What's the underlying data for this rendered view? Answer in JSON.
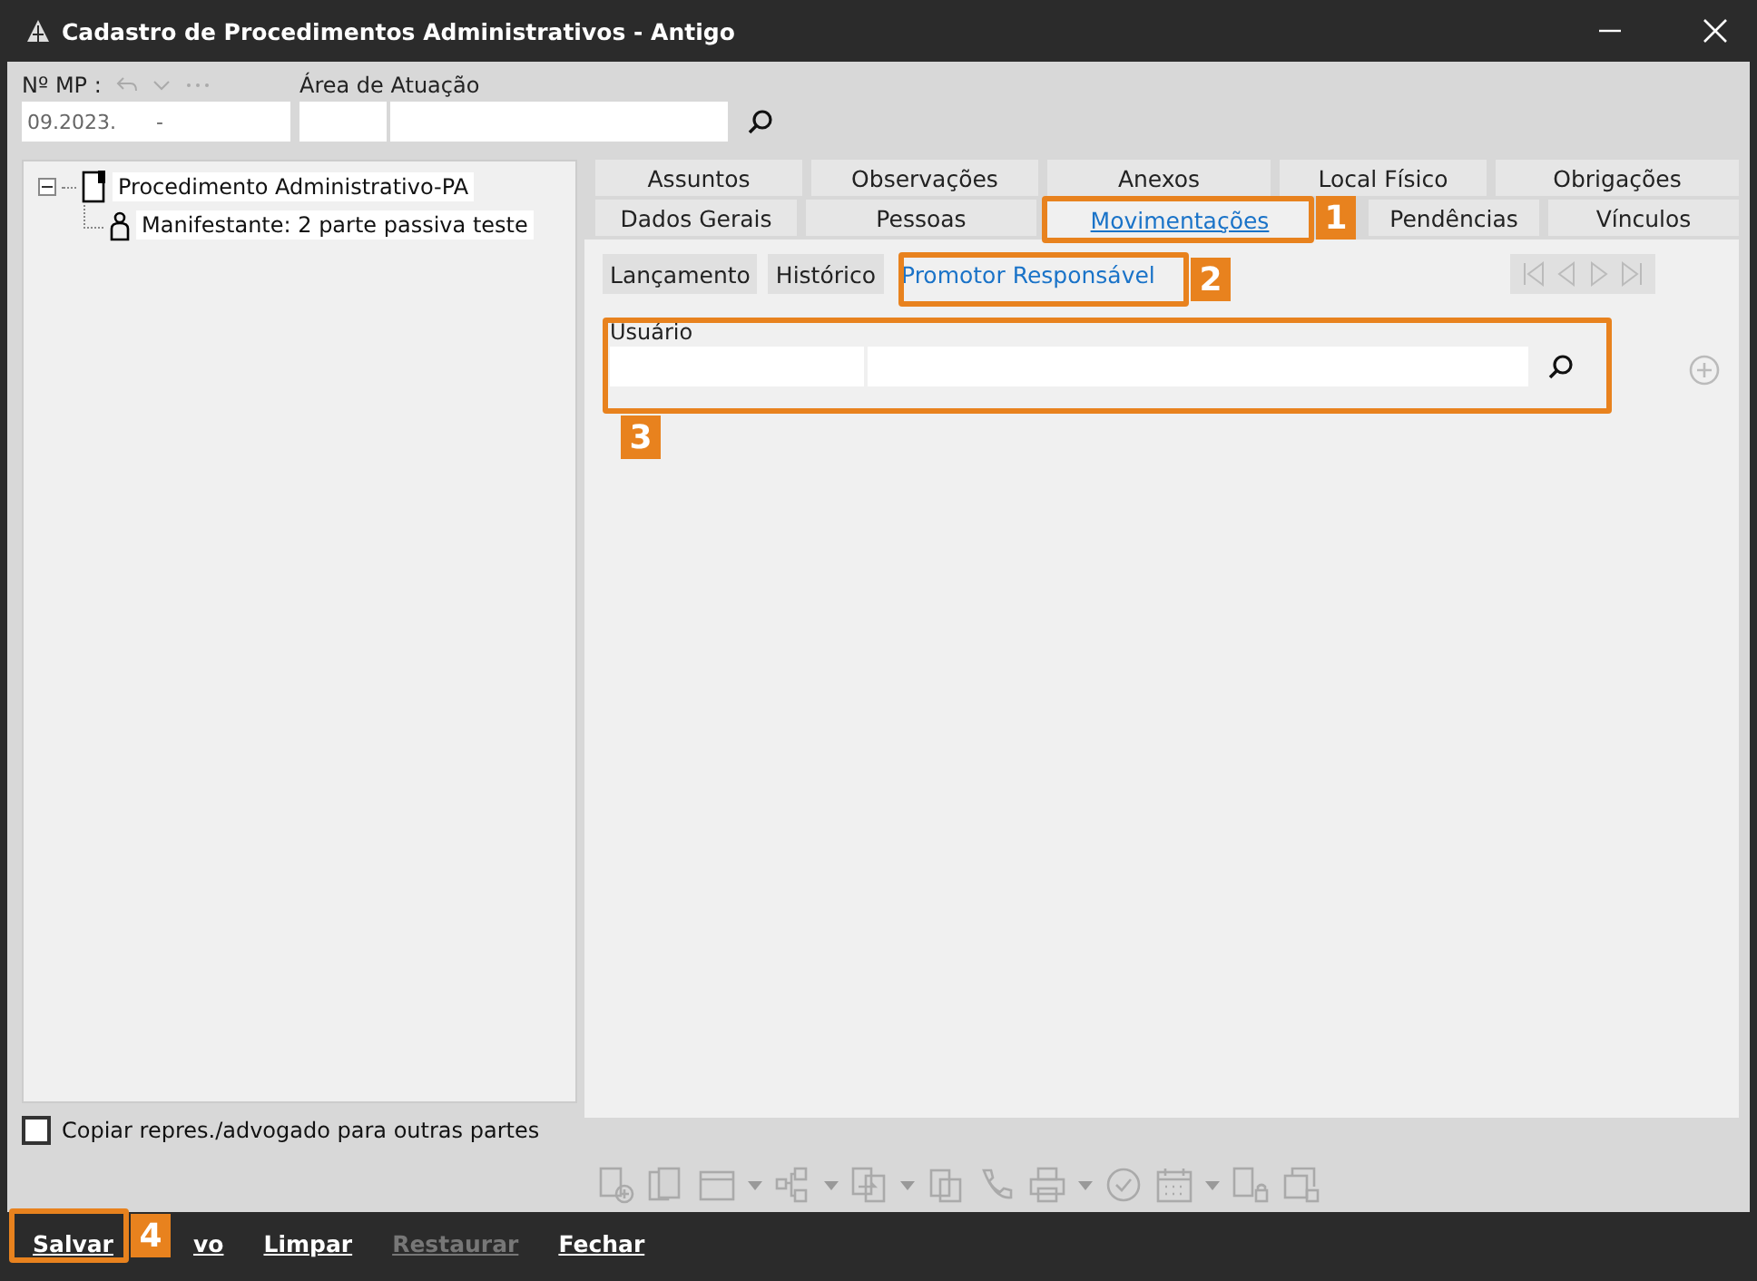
{
  "window": {
    "title": "Cadastro de Procedimentos Administrativos - Antigo"
  },
  "header": {
    "mp_label": "Nº MP :",
    "mp_value": "09.2023.",
    "mp_suffix": "-",
    "area_label": "Área de Atuação"
  },
  "tree": [
    {
      "label": "Procedimento Administrativo-PA",
      "expanded": true,
      "children": [
        {
          "label": "Manifestante: 2 parte passiva teste"
        }
      ]
    }
  ],
  "copy_option": {
    "label": "Copiar repres./advogado para outras partes",
    "checked": false
  },
  "tab_rows": [
    [
      {
        "label": "Assuntos",
        "selected": false
      },
      {
        "label": "Observações",
        "selected": false
      },
      {
        "label": "Anexos",
        "selected": false
      },
      {
        "label": "Local Físico",
        "selected": false
      },
      {
        "label": "Obrigações",
        "selected": false
      }
    ],
    [
      {
        "label": "Dados Gerais",
        "selected": false
      },
      {
        "label": "Pessoas",
        "selected": false
      },
      {
        "label": "Movimentações",
        "selected": true
      },
      {
        "label": "Pendências",
        "selected": false
      },
      {
        "label": "Vínculos",
        "selected": false
      }
    ]
  ],
  "subtabs": [
    {
      "label": "Lançamento",
      "selected": false
    },
    {
      "label": "Histórico",
      "selected": false
    },
    {
      "label": "Promotor Responsável",
      "selected": true
    }
  ],
  "user_field": {
    "label": "Usuário"
  },
  "bottom_buttons": [
    {
      "label": "Salvar",
      "disabled": false
    },
    {
      "label": "vo",
      "disabled": false
    },
    {
      "label": "Limpar",
      "disabled": false
    },
    {
      "label": "Restaurar",
      "disabled": true
    },
    {
      "label": "Fechar",
      "disabled": false
    }
  ],
  "callouts": [
    {
      "number": "1"
    },
    {
      "number": "2"
    },
    {
      "number": "3"
    },
    {
      "number": "4"
    }
  ]
}
